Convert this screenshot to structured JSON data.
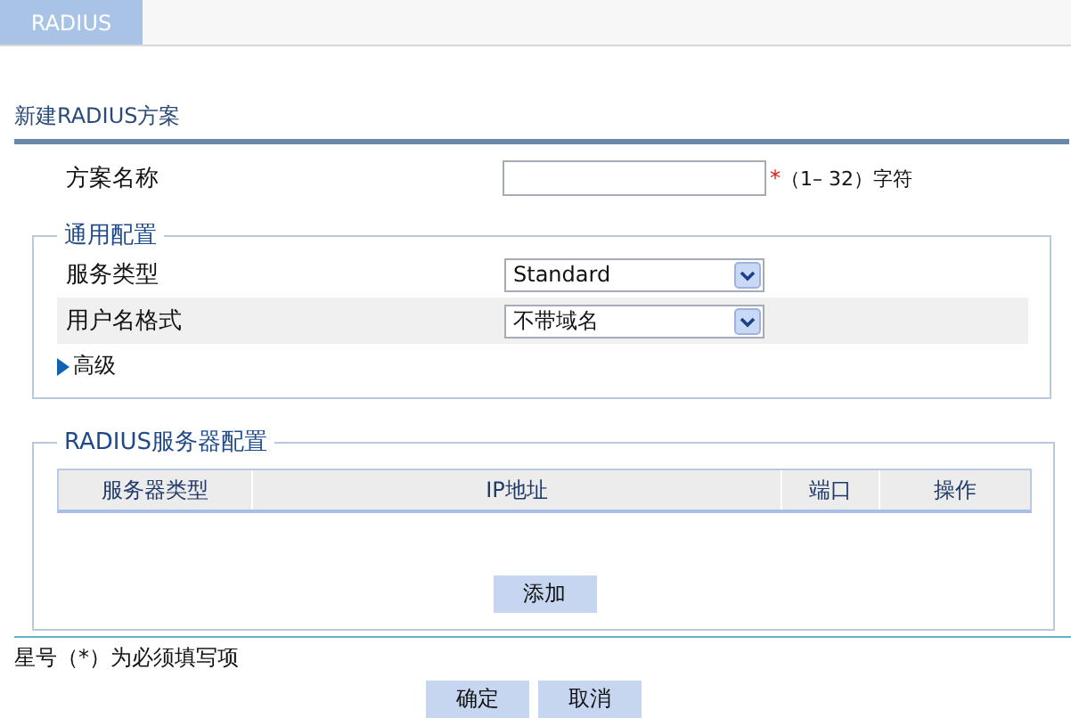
{
  "tabs": [
    {
      "label": "RADIUS",
      "selected": true
    }
  ],
  "section_title": "新建RADIUS方案",
  "scheme_name": {
    "label": "方案名称",
    "required_mark": "*",
    "hint": "（1– 32）字符"
  },
  "general": {
    "legend": "通用配置",
    "fields": [
      {
        "label": "服务类型",
        "value": "Standard",
        "highlighted": false
      },
      {
        "label": "用户名格式",
        "value": "不带域名",
        "highlighted": true
      }
    ],
    "advanced": {
      "label": "高级",
      "expanded": false
    }
  },
  "servers": {
    "legend": "RADIUS服务器配置",
    "columns": [
      "服务器类型",
      "IP地址",
      "端口",
      "操作"
    ],
    "add_button": "添加"
  },
  "footnote": "星号（*）为必须填写项",
  "buttons": [
    "确定",
    "取消"
  ]
}
